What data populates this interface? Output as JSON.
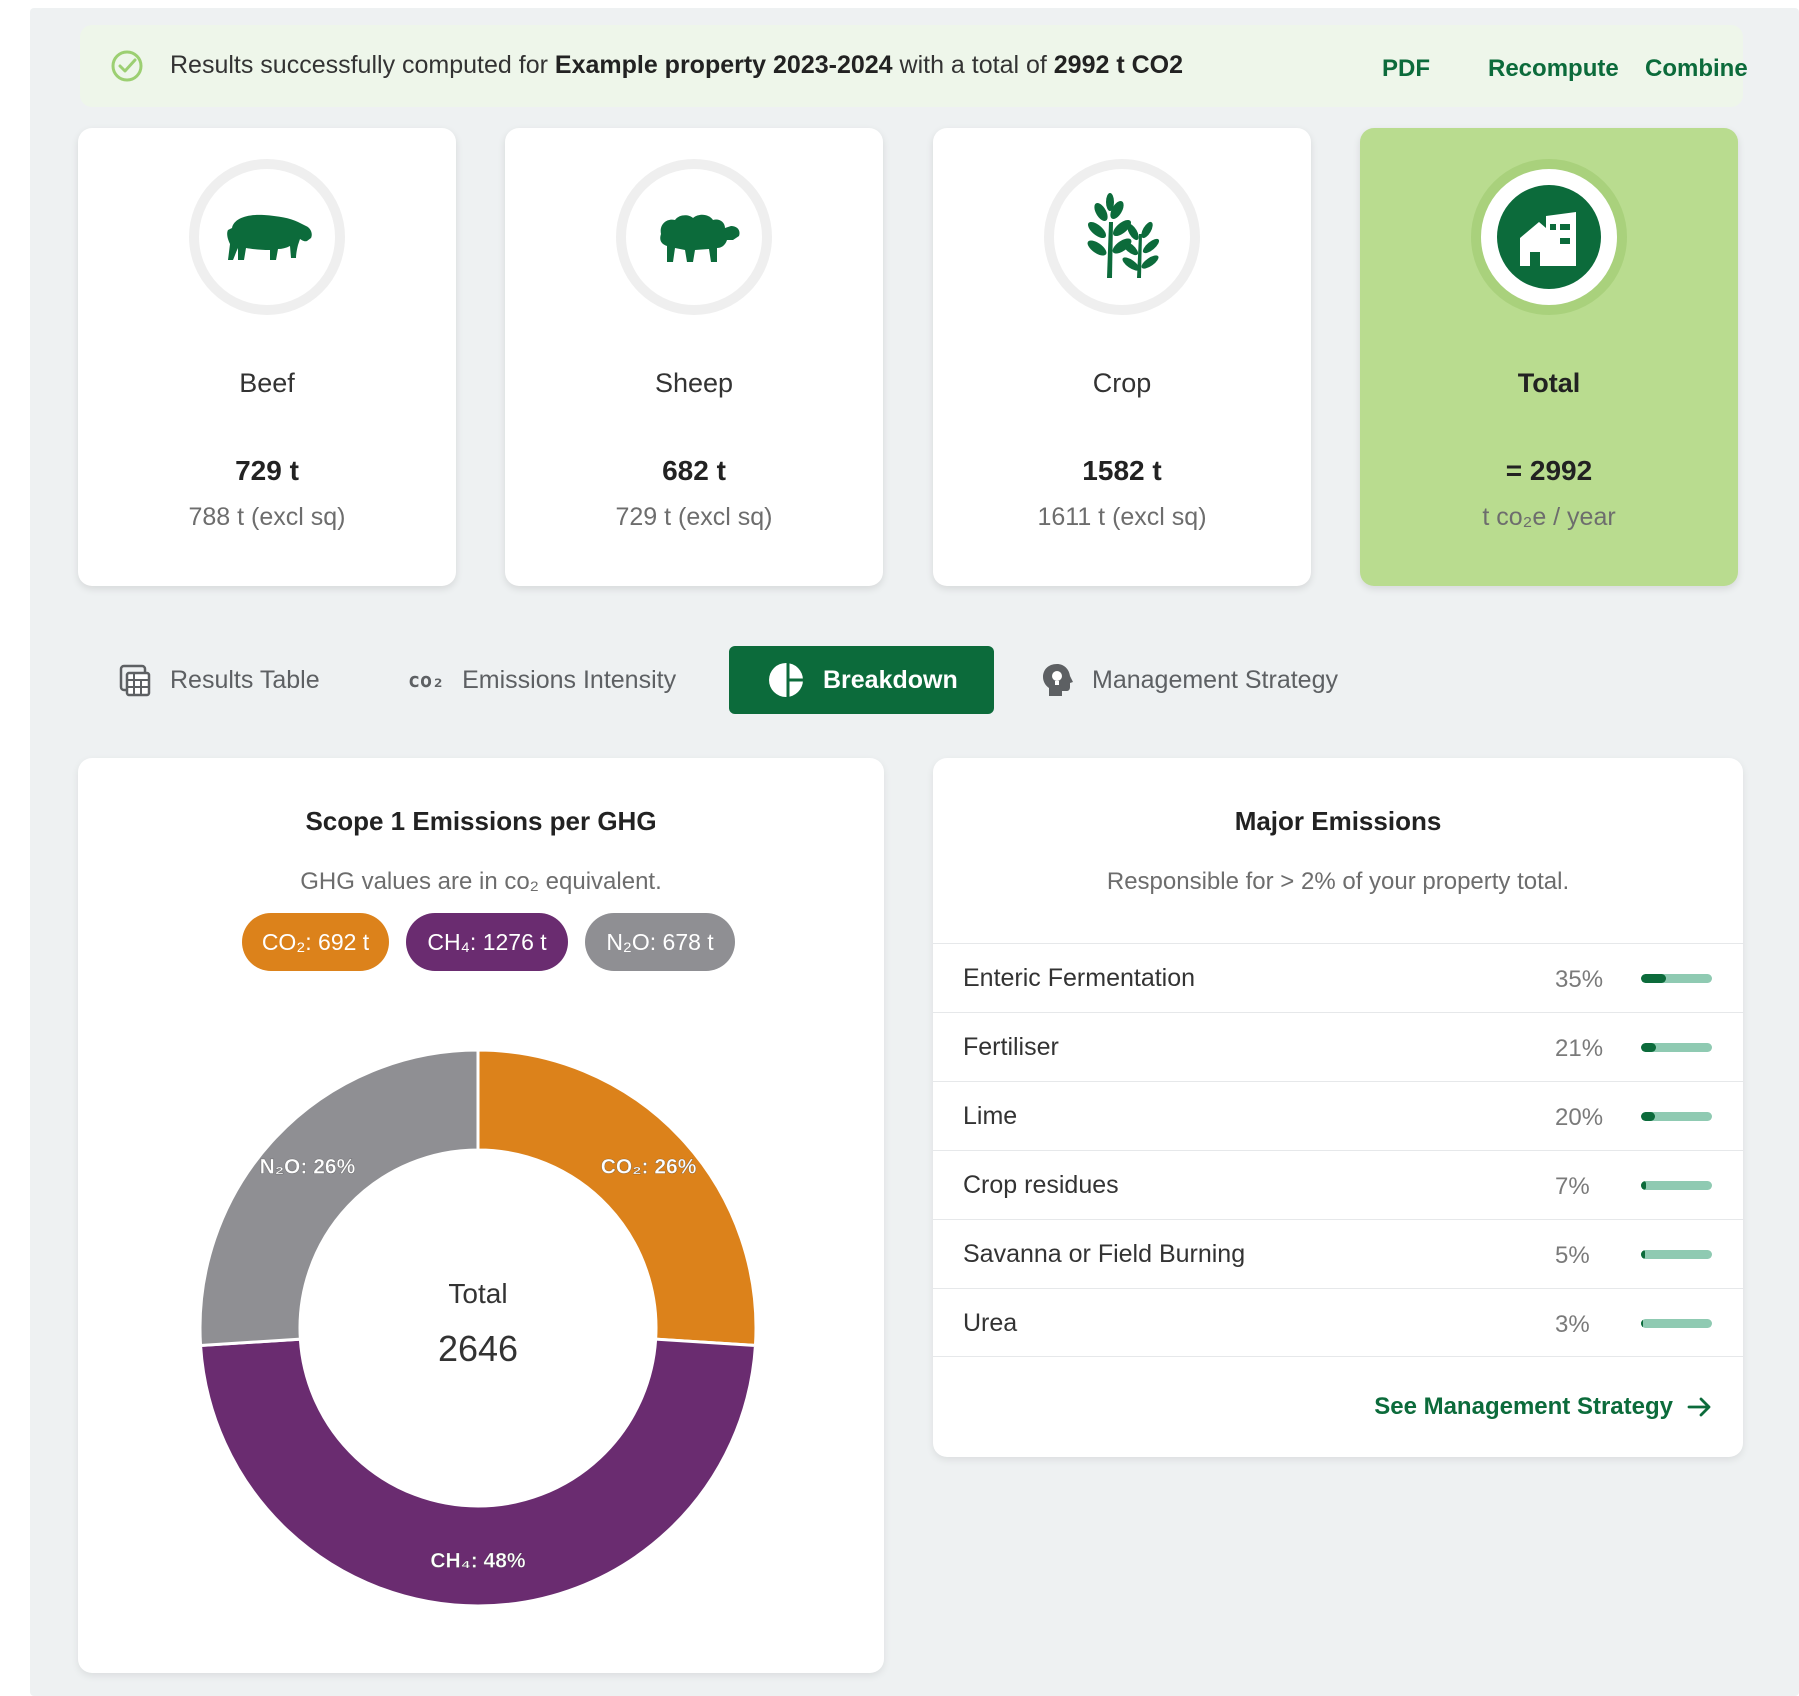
{
  "banner": {
    "prefix": "Results successfully computed for ",
    "property": "Example property 2023-2024",
    "middle": " with a total of ",
    "total": "2992 t CO2",
    "actions": {
      "pdf": "PDF",
      "recompute": "Recompute",
      "combine": "Combine"
    }
  },
  "cards": [
    {
      "name": "Beef",
      "value": "729 t",
      "sub": "788 t (excl sq)",
      "icon": "cow-icon"
    },
    {
      "name": "Sheep",
      "value": "682 t",
      "sub": "729 t (excl sq)",
      "icon": "sheep-icon"
    },
    {
      "name": "Crop",
      "value": "1582 t",
      "sub": "1611 t (excl sq)",
      "icon": "plant-icon"
    },
    {
      "name": "Total",
      "value": "= 2992",
      "sub": "t co₂e / year",
      "icon": "farm-building-icon"
    }
  ],
  "tabs": [
    {
      "label": "Results Table",
      "icon": "table-calculator-icon",
      "active": false
    },
    {
      "label": "Emissions Intensity",
      "icon": "co2-icon",
      "icon_text": "co₂",
      "active": false
    },
    {
      "label": "Breakdown",
      "icon": "pie-chart-icon",
      "active": true
    },
    {
      "label": "Management Strategy",
      "icon": "lightbulb-head-icon",
      "active": false
    }
  ],
  "scope1": {
    "title": "Scope 1 Emissions per GHG",
    "subtitle": "GHG values are in co₂ equivalent.",
    "pills": [
      {
        "label": "CO₂: 692 t",
        "color": "#dc821b"
      },
      {
        "label": "CH₄: 1276 t",
        "color": "#6a2c70"
      },
      {
        "label": "N₂O: 678 t",
        "color": "#8f8f93"
      }
    ],
    "center_label": "Total",
    "center_value": "2646"
  },
  "chart_data": {
    "type": "pie",
    "categories": [
      "CO₂",
      "CH₄",
      "N₂O"
    ],
    "values": [
      26,
      48,
      26
    ],
    "labels": [
      "CO₂: 26%",
      "CH₄: 48%",
      "N₂O: 26%"
    ],
    "colors": [
      "#dc821b",
      "#6a2c70",
      "#8f8f93"
    ]
  },
  "major": {
    "title": "Major Emissions",
    "subtitle": "Responsible for > 2% of your property total.",
    "rows": [
      {
        "name": "Enteric Fermentation",
        "pct": "35%",
        "level": 0.35
      },
      {
        "name": "Fertiliser",
        "pct": "21%",
        "level": 0.21
      },
      {
        "name": "Lime",
        "pct": "20%",
        "level": 0.2
      },
      {
        "name": "Crop residues",
        "pct": "7%",
        "level": 0.07
      },
      {
        "name": "Savanna or Field Burning",
        "pct": "5%",
        "level": 0.05
      },
      {
        "name": "Urea",
        "pct": "3%",
        "level": 0.03
      }
    ],
    "link": "See Management Strategy"
  }
}
